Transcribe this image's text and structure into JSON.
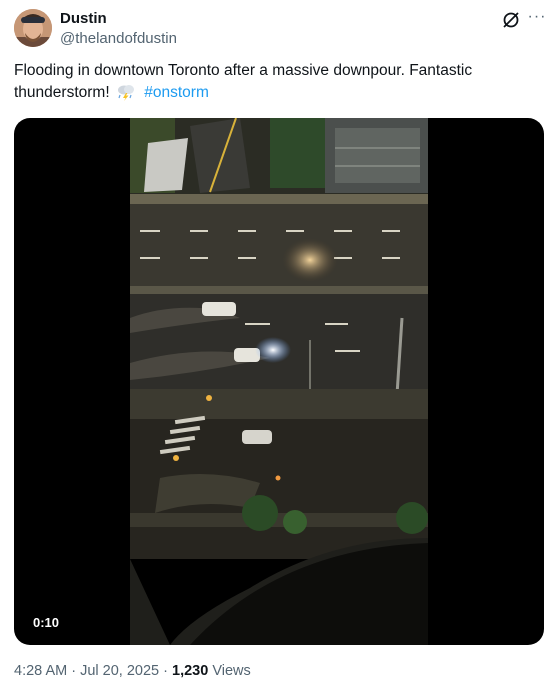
{
  "author": {
    "name": "Dustin",
    "handle": "@thelandofdustin"
  },
  "tweet": {
    "text": "Flooding in downtown Toronto after a massive downpour. Fantastic thunderstorm!",
    "emoji_icon": "thunder-cloud-rain-icon",
    "hashtag": "#onstorm"
  },
  "media": {
    "type": "video",
    "duration": "0:10"
  },
  "meta": {
    "time": "4:28 AM",
    "separator1": " · ",
    "date": "Jul 20, 2025",
    "separator2": " · ",
    "views_count": "1,230",
    "views_label": " Views"
  },
  "icons": [
    "grok-icon",
    "more-options-icon"
  ],
  "colors": {
    "hashtag": "#1d9bf0",
    "secondary_text": "#536471",
    "primary_text": "#0f1419"
  }
}
